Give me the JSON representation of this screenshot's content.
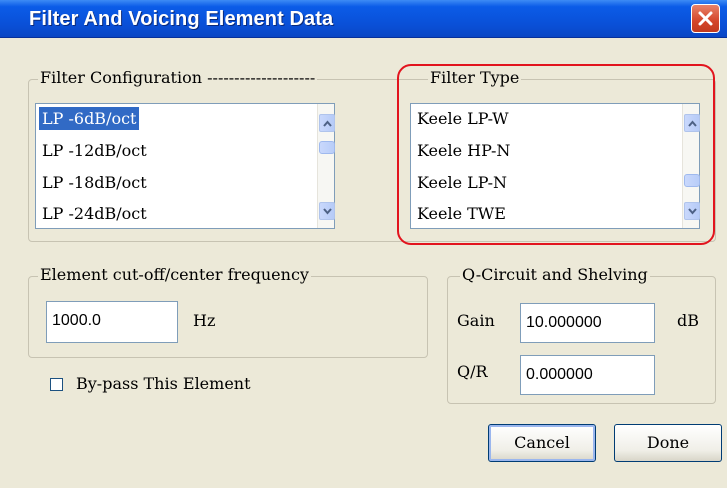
{
  "window": {
    "title": "Filter And Voicing Element Data"
  },
  "filter_config": {
    "label": "Filter Configuration --------------------",
    "items": [
      "LP -6dB/oct",
      "LP -12dB/oct",
      "LP -18dB/oct",
      "LP -24dB/oct"
    ],
    "selected_index": 0
  },
  "filter_type": {
    "label": "Filter Type",
    "items": [
      "Keele LP-W",
      "Keele HP-N",
      "Keele LP-N",
      "Keele TWE"
    ]
  },
  "frequency": {
    "label": "Element cut-off/center frequency",
    "value": "1000.0",
    "unit": "Hz"
  },
  "q_circuit": {
    "label": "Q-Circuit and Shelving",
    "gain_label": "Gain",
    "gain_value": "10.000000",
    "gain_unit": "dB",
    "qr_label": "Q/R",
    "qr_value": "0.000000"
  },
  "bypass": {
    "label": "By-pass This Element",
    "checked": false
  },
  "buttons": {
    "cancel": "Cancel",
    "done": "Done"
  },
  "colors": {
    "title_bar": "#0a4fd6",
    "selection": "#316ac5",
    "annotation_outline": "#e2141e",
    "dialog_bg": "#ece9d8"
  }
}
